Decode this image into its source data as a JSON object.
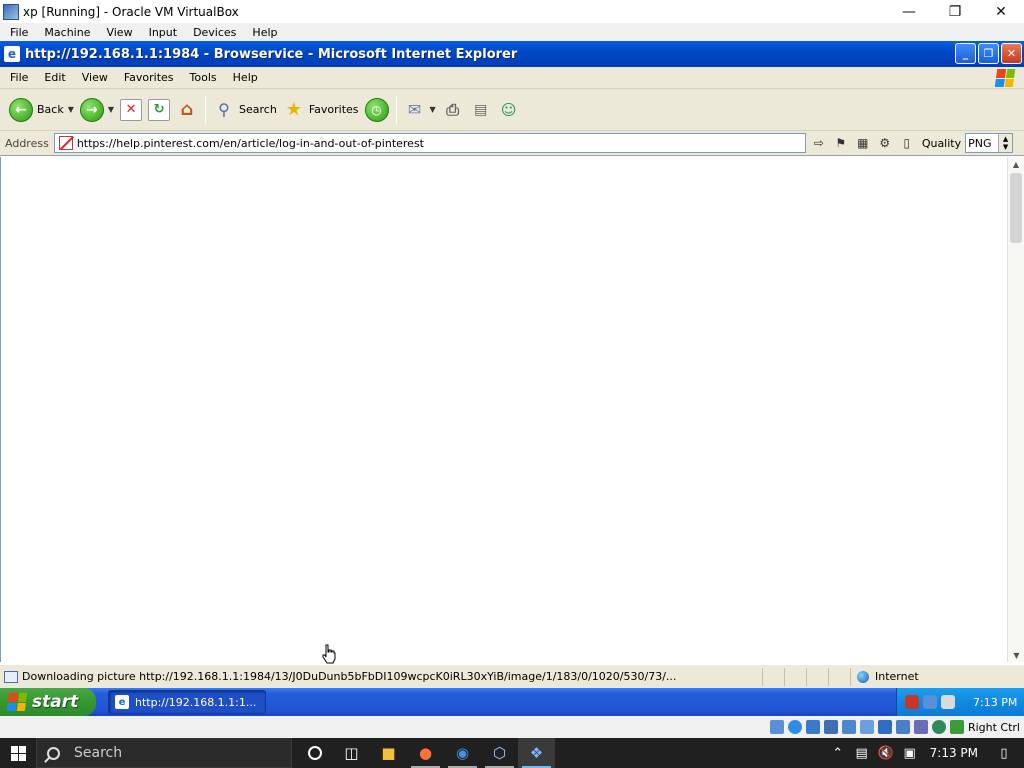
{
  "vbox": {
    "title": "xp [Running] - Oracle VM VirtualBox",
    "menu": [
      "File",
      "Machine",
      "View",
      "Input",
      "Devices",
      "Help"
    ],
    "status_host_key": "Right Ctrl"
  },
  "ie": {
    "title": "http://192.168.1.1:1984 - Browservice - Microsoft Internet Explorer",
    "menu": [
      "File",
      "Edit",
      "View",
      "Favorites",
      "Tools",
      "Help"
    ],
    "toolbar": {
      "back_label": "Back",
      "search_label": "Search",
      "favorites_label": "Favorites"
    },
    "address": {
      "label": "Address",
      "url": "https://help.pinterest.com/en/article/log-in-and-out-of-pinterest"
    },
    "quality": {
      "label": "Quality",
      "value": "PNG"
    },
    "status": {
      "text": "Downloading picture http://192.168.1.1:1984/13/J0DuDunb5bFbDI109wcpcK0iRL30xYiB/image/1/183/0/1020/530/73/...",
      "zone": "Internet"
    }
  },
  "xp_taskbar": {
    "start_label": "start",
    "task_label": "http://192.168.1.1:1...",
    "clock": "7:13 PM"
  },
  "win_taskbar": {
    "search_placeholder": "Search",
    "clock": "7:13 PM"
  }
}
